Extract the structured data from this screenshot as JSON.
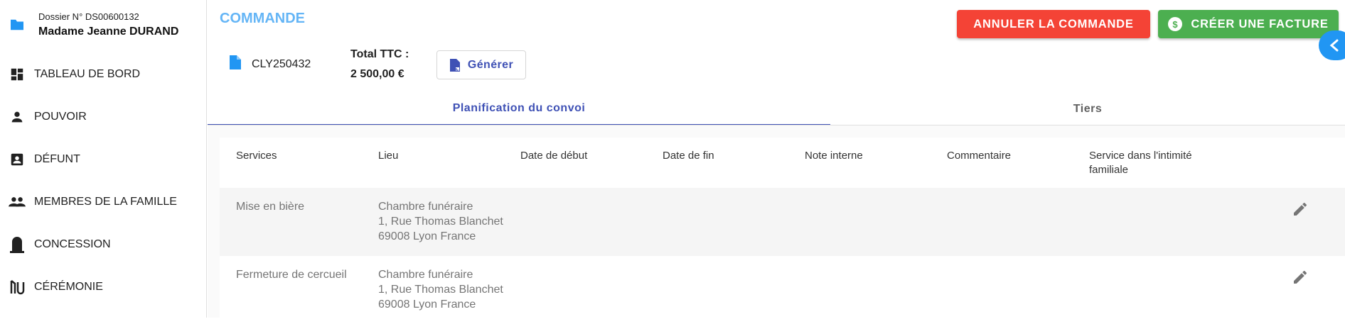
{
  "dossier": {
    "number": "Dossier N° DS00600132",
    "client": "Madame Jeanne DURAND"
  },
  "sidebar": {
    "items": [
      {
        "label": "TABLEAU DE BORD",
        "icon": "dashboard-icon"
      },
      {
        "label": "POUVOIR",
        "icon": "person-icon"
      },
      {
        "label": "DÉFUNT",
        "icon": "contact-card-icon"
      },
      {
        "label": "MEMBRES DE LA FAMILLE",
        "icon": "group-icon"
      },
      {
        "label": "CONCESSION",
        "icon": "tombstone-icon"
      },
      {
        "label": "CÉRÉMONIE",
        "icon": "ceremony-icon"
      }
    ]
  },
  "header": {
    "title": "COMMANDE",
    "cancel_label": "ANNULER LA COMMANDE",
    "invoice_label": "CRÉER UNE FACTURE",
    "invoice_icon": "dollar-circle-icon"
  },
  "order": {
    "code": "CLY250432",
    "total_label": "Total TTC :",
    "total_value": "2 500,00 €",
    "generate_label": "Générer"
  },
  "tabs": [
    {
      "label": "Planification du convoi",
      "active": true
    },
    {
      "label": "Tiers",
      "active": false
    }
  ],
  "table": {
    "columns": [
      "Services",
      "Lieu",
      "Date de début",
      "Date de fin",
      "Note interne",
      "Commentaire",
      "Service dans l'intimité",
      "familiale"
    ],
    "rows": [
      {
        "service": "Mise en bière",
        "lieu_1": "Chambre funéraire",
        "lieu_2": "1, Rue Thomas Blanchet",
        "lieu_3": "69008 Lyon France"
      },
      {
        "service": "Fermeture de cercueil",
        "lieu_1": "Chambre funéraire",
        "lieu_2": "1, Rue Thomas Blanchet",
        "lieu_3": "69008 Lyon France"
      }
    ]
  },
  "colors": {
    "accent": "#3f51b5",
    "title": "#64b5f6",
    "danger": "#f44336",
    "success": "#4caf50",
    "info": "#2196f3"
  }
}
